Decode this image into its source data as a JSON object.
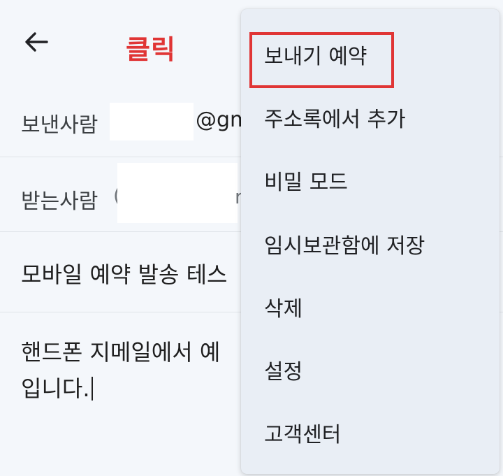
{
  "annotation": {
    "click_label": "클릭",
    "color": "#e03535"
  },
  "toolbar": {
    "back_icon": "arrow-left-icon"
  },
  "compose": {
    "from_label": "보낸사람",
    "from_domain_partial": "@gm",
    "to_label": "받는사람",
    "to_chip_left": "(",
    "to_chip_right": "n",
    "subject": "모바일 예약 발송 테스",
    "body_lines": [
      "핸드폰 지메일에서 예",
      "입니다."
    ]
  },
  "menu": {
    "items": [
      {
        "label": "보내기 예약"
      },
      {
        "label": "주소록에서 추가"
      },
      {
        "label": "비밀 모드"
      },
      {
        "label": "임시보관함에 저장"
      },
      {
        "label": "삭제"
      },
      {
        "label": "설정"
      },
      {
        "label": "고객센터"
      }
    ],
    "background": "#e9eef5"
  }
}
